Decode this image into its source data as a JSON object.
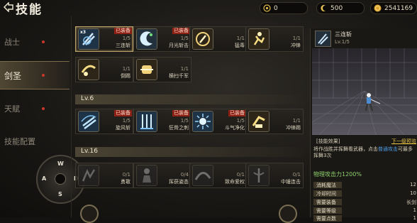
{
  "header": {
    "title": "技能"
  },
  "resources": [
    {
      "icon": "target-icon",
      "value": "0"
    },
    {
      "icon": "crescent-icon",
      "value": "500"
    },
    {
      "icon": "gold-coin-icon",
      "value": "2541169"
    }
  ],
  "nav": [
    {
      "label": "战士",
      "dot": true,
      "active": false
    },
    {
      "label": "剑圣",
      "dot": true,
      "active": true
    },
    {
      "label": "天赋",
      "dot": true,
      "active": false
    },
    {
      "label": "技能配置",
      "dot": false,
      "active": false
    }
  ],
  "dpad": {
    "w": "W",
    "a": "A",
    "s": "S",
    "d": "D"
  },
  "sections": [
    {
      "level_label": "",
      "skills": [
        {
          "name": "三连斩",
          "level": "1/5",
          "badge": "已装备",
          "multiplier": "x3",
          "selected": true,
          "dim": false
        },
        {
          "name": "月光斩击",
          "level": "1/5",
          "badge": "已装备",
          "selected": false,
          "dim": false
        },
        {
          "name": "猛毒",
          "level": "1/1",
          "badge": "",
          "selected": false,
          "dim": false
        },
        {
          "name": "冲锋",
          "level": "1/1",
          "badge": "",
          "selected": false,
          "dim": false
        },
        {
          "name": "倒踢",
          "level": "1/1",
          "badge": "",
          "selected": false,
          "dim": false
        },
        {
          "name": "横扫千军",
          "level": "1/1",
          "badge": "",
          "selected": false,
          "dim": false
        }
      ]
    },
    {
      "level_label": "Lv.6",
      "skills": [
        {
          "name": "旋风斩",
          "level": "1/5",
          "badge": "已装备",
          "selected": false,
          "dim": false
        },
        {
          "name": "狂骨之刺",
          "level": "1/5",
          "badge": "已装备",
          "selected": false,
          "dim": false
        },
        {
          "name": "斗气净化",
          "level": "1/5",
          "badge": "已装备",
          "selected": false,
          "dim": false
        },
        {
          "name": "冲锋踢",
          "level": "1/1",
          "badge": "",
          "selected": false,
          "dim": false
        }
      ]
    },
    {
      "level_label": "Lv.16",
      "skills": [
        {
          "name": "勇敢",
          "level": "0/1",
          "badge": "",
          "selected": false,
          "dim": true
        },
        {
          "name": "挥获姿态",
          "level": "0/4",
          "badge": "",
          "selected": false,
          "dim": true
        },
        {
          "name": "致命爱权",
          "level": "0/1",
          "badge": "",
          "selected": false,
          "dim": true
        },
        {
          "name": "中锤连击",
          "level": "0/1",
          "badge": "",
          "selected": false,
          "dim": true
        }
      ]
    }
  ],
  "detail": {
    "name": "三连斩",
    "level": "Lv.1/5",
    "effect_tab": "[技能效果]",
    "next_link": "下一级预览",
    "desc_prefix": "将作战胜并挥舞看武器，点击",
    "desc_highlight": "普通攻击",
    "desc_suffix": "可最多挥舞3次",
    "phys_attack": "物理攻击力1200%",
    "stats": [
      {
        "key": "消耗魔法",
        "value": "12"
      },
      {
        "key": "冷却时间",
        "value": "10"
      },
      {
        "key": "需要装备",
        "value": "长剑"
      },
      {
        "key": "需要等级",
        "value": "1"
      },
      {
        "key": "需要点数",
        "value": "1"
      }
    ]
  },
  "colors": {
    "accent": "#b9a169",
    "badge": "#8f2217",
    "highlight": "#4f9fe8",
    "phys": "#8fd06a",
    "link": "#e7c548"
  }
}
